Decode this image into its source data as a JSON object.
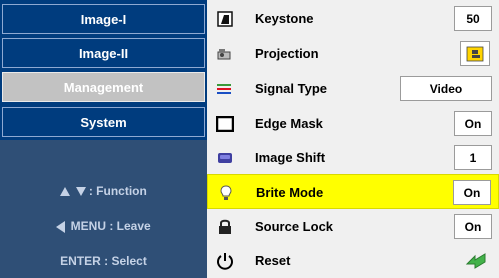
{
  "left_nav": {
    "items": [
      {
        "label": "Image-I"
      },
      {
        "label": "Image-II"
      },
      {
        "label": "Management"
      },
      {
        "label": "System"
      }
    ]
  },
  "hints": {
    "function": ": Function",
    "leave": "MENU : Leave",
    "select": "ENTER : Select"
  },
  "settings": [
    {
      "label": "Keystone",
      "icon": "keystone-icon",
      "value": "50"
    },
    {
      "label": "Projection",
      "icon": "projection-icon"
    },
    {
      "label": "Signal Type",
      "icon": "signal-type-icon",
      "value": "Video"
    },
    {
      "label": "Edge Mask",
      "icon": "edge-mask-icon",
      "value": "On"
    },
    {
      "label": "Image Shift",
      "icon": "image-shift-icon",
      "value": "1"
    },
    {
      "label": "Brite Mode",
      "icon": "brite-mode-icon",
      "value": "On"
    },
    {
      "label": "Source Lock",
      "icon": "source-lock-icon",
      "value": "On"
    },
    {
      "label": "Reset",
      "icon": "power-icon"
    }
  ],
  "colors": {
    "nav_bg": "#003c7e",
    "active_tab": "#c2c2c2",
    "hint_bg": "#2f4f76",
    "selected_row": "#ffff00"
  }
}
